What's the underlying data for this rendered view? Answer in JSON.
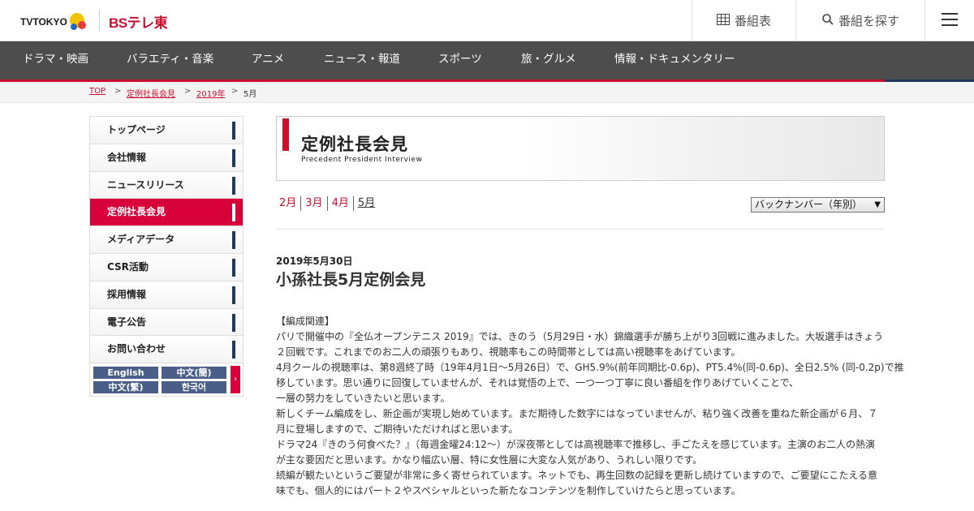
{
  "header": {
    "logo_tv": "TVTOKYO",
    "logo_bs": "BSテレ東",
    "schedule_label": "番組表",
    "search_label": "番組を探す"
  },
  "nav": [
    "ドラマ・映画",
    "バラエティ・音楽",
    "アニメ",
    "ニュース・報道",
    "スポーツ",
    "旅・グルメ",
    "情報・ドキュメンタリー"
  ],
  "breadcrumb": {
    "items": [
      "TOP",
      "定例社長会見",
      "2019年"
    ],
    "separator": ">",
    "current": "5月"
  },
  "sidebar": {
    "items": [
      "トップページ",
      "会社情報",
      "ニュースリリース",
      "定例社長会見",
      "メディアデータ",
      "CSR活動",
      "採用情報",
      "電子公告",
      "お問い合わせ"
    ],
    "active_index": 3,
    "languages": [
      "English",
      "中文(簡)",
      "中文(繁)",
      "한국어"
    ]
  },
  "page": {
    "title": "定例社長会見",
    "subtitle": "Precedent President Interview",
    "months": [
      "2月",
      "3月",
      "4月",
      "5月"
    ],
    "current_month": "5月",
    "backnumber_label": "バックナンバー（年別）"
  },
  "article": {
    "date": "2019年5月30日",
    "title": "小孫社長5月定例会見",
    "lines": [
      "【編成関連】",
      "パリで開催中の『全仏オープンテニス 2019』では、きのう（5月29日・水）錦織選手が勝ち上がり3回戦に進みました。大坂選手はきょう",
      "２回戦です。これまでのお二人の頑張りもあり、視聴率もこの時間帯としては高い視聴率をあげています。",
      "4月クールの視聴率は、第8週終了時（19年4月1日～5月26日）で、GH5.9%(前年同期比-0.6p)、PT5.4%(同-0.6p)、全日2.5% (同-0.2p)で推",
      "移しています。思い通りに回復していませんが、それは覚悟の上で、一つ一つ丁寧に良い番組を作りあげていくことで、",
      "一層の努力をしていきたいと思います。",
      "新しくチーム編成をし、新企画が実現し始めています。まだ期待した数字にはなっていませんが、粘り強く改善を重ねた新企画が６月、７",
      "月に登場しますので、ご期待いただければと思います。",
      "ドラマ24『きのう何食べた？』（毎週金曜24:12～）が深夜帯としては高視聴率で推移し、手ごたえを感じています。主演のお二人の熱演",
      "が主な要因だと思います。かなり幅広い層、特に女性層に大変な人気があり、うれしい限りです。",
      "続編が観たいというご要望が非常に多く寄せられています。ネットでも、再生回数の記録を更新し続けていますので、ご要望にこたえる意",
      "味でも、個人的にはパート２やスペシャルといった新たなコンテンツを制作していけたらと思っています。"
    ]
  },
  "colors": {
    "brand_red": "#c8102e",
    "active_red": "#d7003a",
    "nav_bg": "#4d4d4d",
    "navy": "#1f3b5c"
  }
}
